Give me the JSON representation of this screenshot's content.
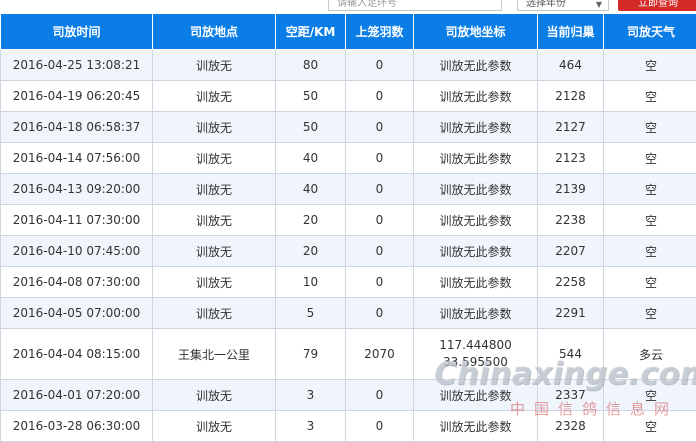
{
  "topbar": {
    "notice": "",
    "search_placeholder": "请输入足环号",
    "select_value": "选择年份",
    "button_label": "立即查询"
  },
  "table": {
    "headers": [
      "司放时间",
      "司放地点",
      "空距/KM",
      "上笼羽数",
      "司放地坐标",
      "当前归巢",
      "司放天气"
    ],
    "rows": [
      {
        "time": "2016-04-25 13:08:21",
        "place": "训放无",
        "distance": "80",
        "birds": "0",
        "coord_line1": "训放无此参数",
        "coord_line2": "",
        "returned": "464",
        "weather": "空"
      },
      {
        "time": "2016-04-19 06:20:45",
        "place": "训放无",
        "distance": "50",
        "birds": "0",
        "coord_line1": "训放无此参数",
        "coord_line2": "",
        "returned": "2128",
        "weather": "空"
      },
      {
        "time": "2016-04-18 06:58:37",
        "place": "训放无",
        "distance": "50",
        "birds": "0",
        "coord_line1": "训放无此参数",
        "coord_line2": "",
        "returned": "2127",
        "weather": "空"
      },
      {
        "time": "2016-04-14 07:56:00",
        "place": "训放无",
        "distance": "40",
        "birds": "0",
        "coord_line1": "训放无此参数",
        "coord_line2": "",
        "returned": "2123",
        "weather": "空"
      },
      {
        "time": "2016-04-13 09:20:00",
        "place": "训放无",
        "distance": "40",
        "birds": "0",
        "coord_line1": "训放无此参数",
        "coord_line2": "",
        "returned": "2139",
        "weather": "空"
      },
      {
        "time": "2016-04-11 07:30:00",
        "place": "训放无",
        "distance": "20",
        "birds": "0",
        "coord_line1": "训放无此参数",
        "coord_line2": "",
        "returned": "2238",
        "weather": "空"
      },
      {
        "time": "2016-04-10 07:45:00",
        "place": "训放无",
        "distance": "20",
        "birds": "0",
        "coord_line1": "训放无此参数",
        "coord_line2": "",
        "returned": "2207",
        "weather": "空"
      },
      {
        "time": "2016-04-08 07:30:00",
        "place": "训放无",
        "distance": "10",
        "birds": "0",
        "coord_line1": "训放无此参数",
        "coord_line2": "",
        "returned": "2258",
        "weather": "空"
      },
      {
        "time": "2016-04-05 07:00:00",
        "place": "训放无",
        "distance": "5",
        "birds": "0",
        "coord_line1": "训放无此参数",
        "coord_line2": "",
        "returned": "2291",
        "weather": "空"
      },
      {
        "time": "2016-04-04 08:15:00",
        "place": "王集北一公里",
        "distance": "79",
        "birds": "2070",
        "coord_line1": "117.444800",
        "coord_line2": "33.595500",
        "returned": "544",
        "weather": "多云"
      },
      {
        "time": "2016-04-01 07:20:00",
        "place": "训放无",
        "distance": "3",
        "birds": "0",
        "coord_line1": "训放无此参数",
        "coord_line2": "",
        "returned": "2337",
        "weather": "空"
      },
      {
        "time": "2016-03-28 06:30:00",
        "place": "训放无",
        "distance": "3",
        "birds": "0",
        "coord_line1": "训放无此参数",
        "coord_line2": "",
        "returned": "2328",
        "weather": "空"
      }
    ]
  },
  "watermark": {
    "main": "Chinaxinge.com",
    "sub": "中国信鸽信息网"
  },
  "colors": {
    "header_bg": "#0a7ee6",
    "row_alt_bg": "#f0f5fc",
    "button_bg": "#d42a28",
    "border": "#cfd6e0"
  }
}
